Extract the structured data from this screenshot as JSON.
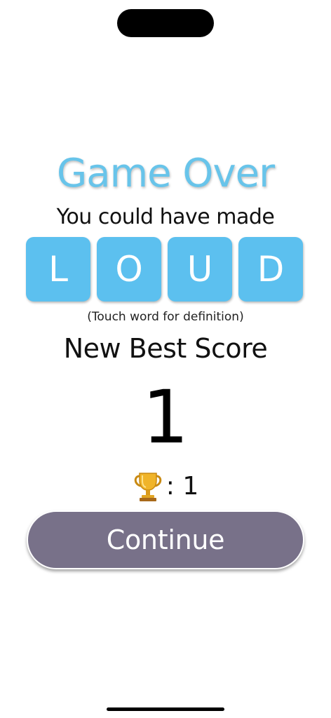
{
  "game_over": {
    "title": "Game Over",
    "subtitle": "You could have made",
    "word_letters": [
      "L",
      "O",
      "U",
      "D"
    ],
    "hint": "(Touch word for definition)",
    "best_score_label": "New Best Score",
    "score": "1",
    "trophy_icon": "trophy-icon",
    "trophy_count": ": 1",
    "continue_label": "Continue"
  },
  "colors": {
    "title": "#68c4ea",
    "tile": "#5cc0ef",
    "continue_button": "#787189"
  }
}
